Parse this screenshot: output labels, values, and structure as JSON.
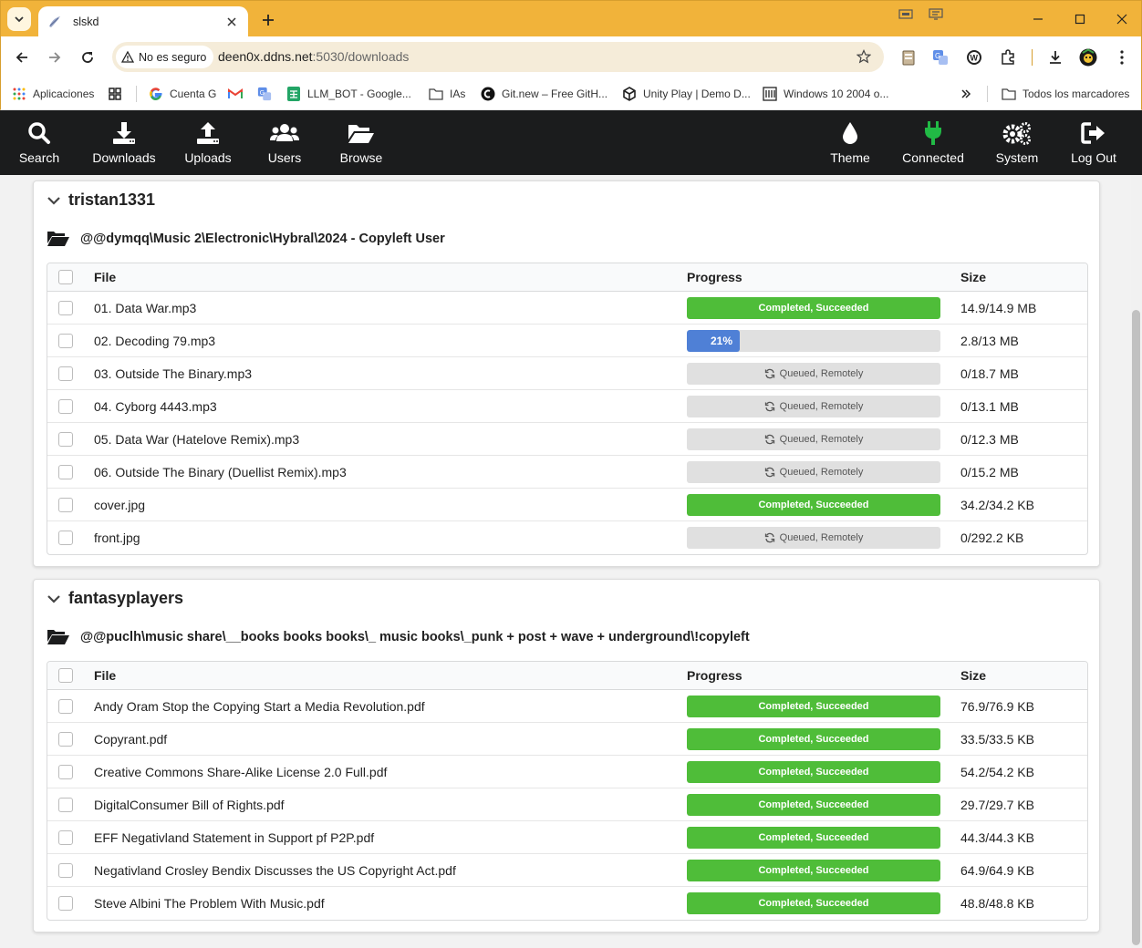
{
  "browser": {
    "tab_title": "slskd",
    "security_label": "No es seguro",
    "url_host": "deen0x.ddns.net",
    "url_path": ":5030/downloads",
    "bookmarks": [
      {
        "label": "Aplicaciones",
        "icon": "apps-grid-icon"
      },
      {
        "label": "",
        "icon": "dashboard-grid-icon"
      },
      {
        "label": "Cuenta G",
        "icon": "google-icon"
      },
      {
        "label": "",
        "icon": "gmail-icon"
      },
      {
        "label": "",
        "icon": "translate-icon"
      },
      {
        "label": "LLM_BOT - Google...",
        "icon": "sheets-icon"
      },
      {
        "label": "IAs",
        "icon": "folder-icon"
      },
      {
        "label": "Git.new – Free GitH...",
        "icon": "gitnew-icon"
      },
      {
        "label": "Unity Play | Demo D...",
        "icon": "unity-icon"
      },
      {
        "label": "Windows 10 2004 o...",
        "icon": "windows-icon"
      }
    ],
    "all_bookmarks_label": "Todos los marcadores"
  },
  "nav": {
    "search": "Search",
    "downloads": "Downloads",
    "uploads": "Uploads",
    "users": "Users",
    "browse": "Browse",
    "theme": "Theme",
    "connected": "Connected",
    "system": "System",
    "logout": "Log Out"
  },
  "table_headers": {
    "file": "File",
    "progress": "Progress",
    "size": "Size"
  },
  "groups": [
    {
      "user": "tristan1331",
      "directory": "@@dymqq\\Music 2\\Electronic\\Hybral\\2024 - Copyleft User",
      "files": [
        {
          "name": "01. Data War.mp3",
          "state": "Completed, Succeeded",
          "percent": 100,
          "size": "14.9/14.9 MB"
        },
        {
          "name": "02. Decoding 79.mp3",
          "state": "21%",
          "percent": 21,
          "size": "2.8/13 MB"
        },
        {
          "name": "03. Outside The Binary.mp3",
          "state": "Queued, Remotely",
          "percent": 0,
          "size": "0/18.7 MB"
        },
        {
          "name": "04. Cyborg 4443.mp3",
          "state": "Queued, Remotely",
          "percent": 0,
          "size": "0/13.1 MB"
        },
        {
          "name": "05. Data War (Hatelove Remix).mp3",
          "state": "Queued, Remotely",
          "percent": 0,
          "size": "0/12.3 MB"
        },
        {
          "name": "06. Outside The Binary (Duellist Remix).mp3",
          "state": "Queued, Remotely",
          "percent": 0,
          "size": "0/15.2 MB"
        },
        {
          "name": "cover.jpg",
          "state": "Completed, Succeeded",
          "percent": 100,
          "size": "34.2/34.2 KB"
        },
        {
          "name": "front.jpg",
          "state": "Queued, Remotely",
          "percent": 0,
          "size": "0/292.2 KB"
        }
      ]
    },
    {
      "user": "fantasyplayers",
      "directory": "@@puclh\\music share\\__books books books\\_ music books\\_punk + post + wave + underground\\!copyleft",
      "files": [
        {
          "name": "Andy Oram Stop the Copying Start a Media Revolution.pdf",
          "state": "Completed, Succeeded",
          "percent": 100,
          "size": "76.9/76.9 KB"
        },
        {
          "name": "Copyrant.pdf",
          "state": "Completed, Succeeded",
          "percent": 100,
          "size": "33.5/33.5 KB"
        },
        {
          "name": "Creative Commons Share-Alike License 2.0 Full.pdf",
          "state": "Completed, Succeeded",
          "percent": 100,
          "size": "54.2/54.2 KB"
        },
        {
          "name": "DigitalConsumer Bill of Rights.pdf",
          "state": "Completed, Succeeded",
          "percent": 100,
          "size": "29.7/29.7 KB"
        },
        {
          "name": "EFF Negativland Statement in Support pf P2P.pdf",
          "state": "Completed, Succeeded",
          "percent": 100,
          "size": "44.3/44.3 KB"
        },
        {
          "name": "Negativland Crosley Bendix Discusses the US Copyright Act.pdf",
          "state": "Completed, Succeeded",
          "percent": 100,
          "size": "64.9/64.9 KB"
        },
        {
          "name": "Steve Albini The Problem With Music.pdf",
          "state": "Completed, Succeeded",
          "percent": 100,
          "size": "48.8/48.8 KB"
        }
      ]
    }
  ],
  "colors": {
    "tabbar": "#f1b33a",
    "navbar_bg": "#1b1c1d",
    "completed": "#4fbd39",
    "in_progress": "#4f80d6",
    "queued": "#e0e0e0",
    "connected": "#21ba45"
  }
}
